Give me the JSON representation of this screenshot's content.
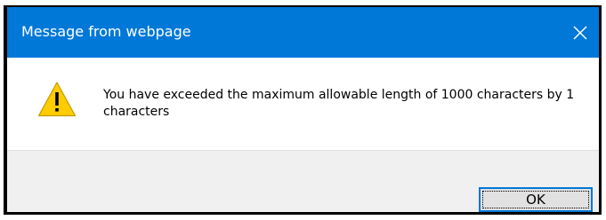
{
  "dialog": {
    "title": "Message from webpage",
    "message": "You have exceeded the maximum allowable length of 1000 characters by 1 characters",
    "ok_label": "OK",
    "icons": {
      "close": "close-icon",
      "warning": "warning-icon"
    }
  },
  "colors": {
    "titlebar": "#0078d7",
    "title_text": "#ffffff",
    "footer": "#f0f0f0",
    "button_face": "#e1e1e1",
    "button_focus_border": "#0078d7",
    "warning_fill": "#ffcc00"
  }
}
